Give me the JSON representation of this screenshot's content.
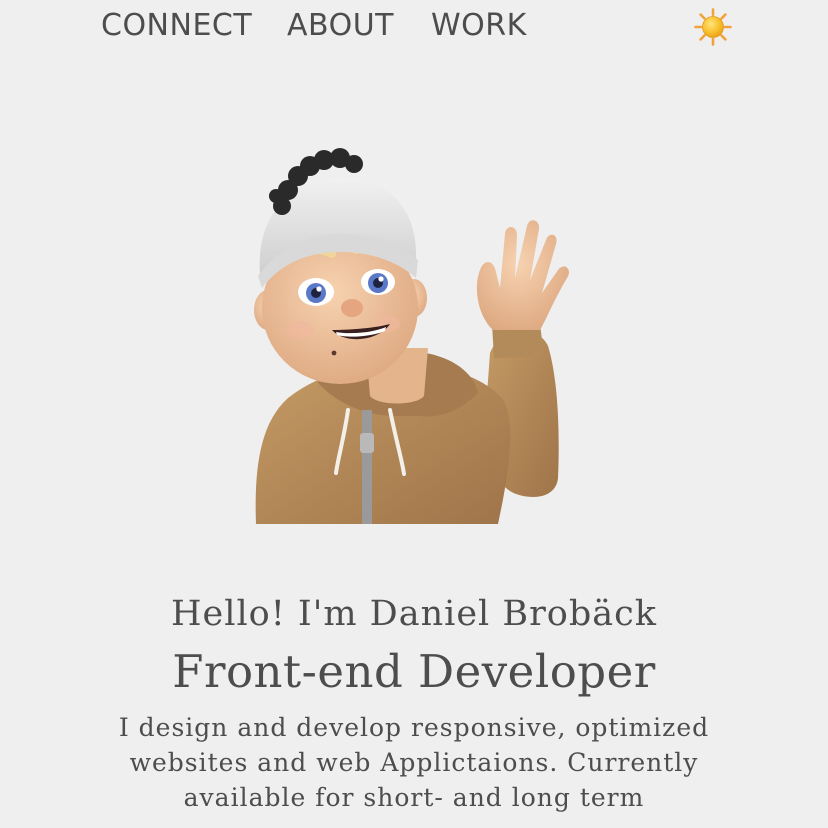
{
  "nav": {
    "items": [
      {
        "label": "CONNECT"
      },
      {
        "label": "ABOUT"
      },
      {
        "label": "WORK"
      }
    ],
    "theme_toggle_icon": "sun-icon"
  },
  "hero": {
    "avatar_icon": "waving-memoji-avatar",
    "greeting": "Hello! I'm Daniel Brobäck",
    "role": "Front-end Developer",
    "intro": "I design and develop responsive, optimized websites and web Applictaions. Currently available for short- and long term"
  },
  "colors": {
    "background": "#efefef",
    "text": "#4d4d4d",
    "sun": "#f5b324",
    "hoodie": "#b08452",
    "beanie": "#e2e2e2"
  }
}
